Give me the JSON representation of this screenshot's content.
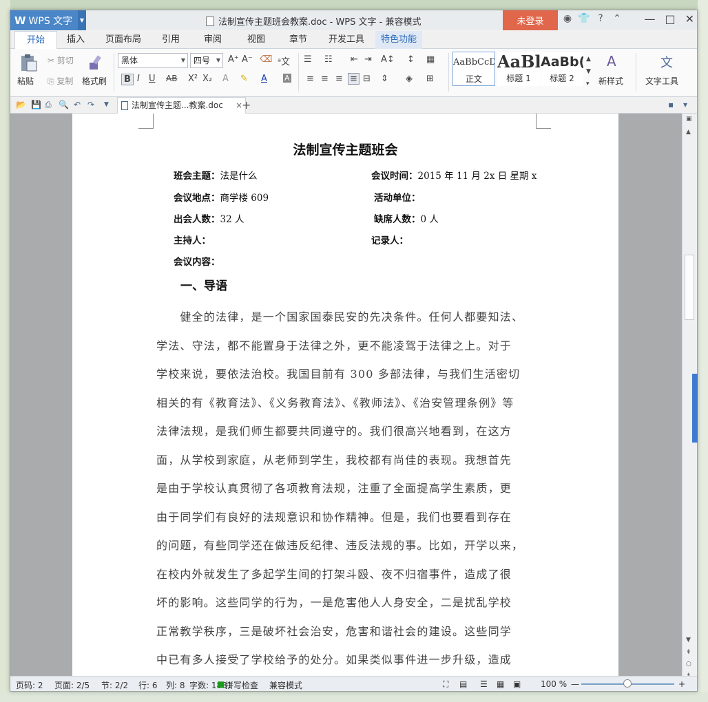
{
  "window": {
    "app_label": "WPS 文字",
    "title": "法制宣传主题班会教案.doc - WPS 文字 - 兼容模式",
    "login_label": "未登录"
  },
  "tabs": [
    "开始",
    "插入",
    "页面布局",
    "引用",
    "审阅",
    "视图",
    "章节",
    "开发工具",
    "特色功能"
  ],
  "ribbon": {
    "paste": "粘贴",
    "cut": "剪切",
    "copy": "复制",
    "format_painter": "格式刷",
    "font_name": "黑体",
    "font_size": "四号",
    "styles": [
      {
        "preview": "AaBbCcD",
        "label": "正文"
      },
      {
        "preview": "AaBl",
        "label": "标题 1"
      },
      {
        "preview": "AaBb(",
        "label": "标题 2"
      }
    ],
    "new_style": "新样式",
    "text_tools": "文字工具"
  },
  "doc_tab": {
    "name": "法制宣传主题...教案.doc"
  },
  "document": {
    "heading": "法制宣传主题班会",
    "fields": [
      {
        "label": "班会主题：",
        "value": "法是什么"
      },
      {
        "label": "会议时间：",
        "value": "2015 年 11 月 2x 日  星期 x"
      },
      {
        "label": "会议地点：",
        "value": "商学楼 609"
      },
      {
        "label": "活动单位：",
        "value": ""
      },
      {
        "label": "出会人数：",
        "value": "32 人"
      },
      {
        "label": "缺席人数：",
        "value": "0 人"
      },
      {
        "label": "主持人：",
        "value": ""
      },
      {
        "label": "记录人：",
        "value": ""
      },
      {
        "label": "会议内容：",
        "value": ""
      }
    ],
    "section_title": "一、导语",
    "body_lines": [
      "　　健全的法律，是一个国家国泰民安的先决条件。任何人都要知法、",
      "学法、守法，都不能置身于法律之外，更不能凌驾于法律之上。对于",
      "学校来说，要依法治校。我国目前有 300 多部法律，与我们生活密切",
      "相关的有《教育法》、《义务教育法》、《教师法》、《治安管理条例》等",
      "法律法规，是我们师生都要共同遵守的。我们很高兴地看到，在这方",
      "面，从学校到家庭，从老师到学生，我校都有尚佳的表现。我想首先",
      "是由于学校认真贯彻了各项教育法规，注重了全面提高学生素质，更",
      "由于同学们有良好的法规意识和协作精神。但是，我们也要看到存在",
      "的问题，有些同学还在做违反纪律、违反法规的事。比如，开学以来，",
      "在校内外就发生了多起学生间的打架斗殴、夜不归宿事件，造成了很",
      "坏的影响。这些同学的行为，一是危害他人人身安全，二是扰乱学校",
      "正常教学秩序，三是破坏社会治安，危害和谐社会的建设。这些同学",
      "中已有多人接受了学校给予的处分。如果类似事件进一步升级，造成"
    ]
  },
  "status": {
    "page_code": "页码: 2",
    "page": "页面: 2/5",
    "section": "节: 2/2",
    "row": "行: 6",
    "col": "列: 8",
    "word_count": "字数: 1881",
    "spell_check": "拼写检查",
    "compat_mode": "兼容模式",
    "zoom": "100 %"
  },
  "colors": {
    "brand": "#4a86c8",
    "login": "#e0674b",
    "active_tab_text": "#2b6cbf"
  }
}
